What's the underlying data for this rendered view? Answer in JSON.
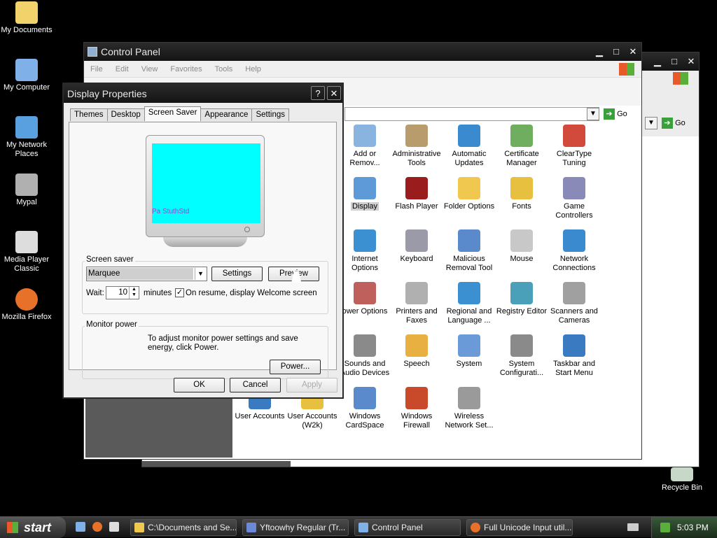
{
  "desktop": {
    "icons": [
      {
        "label": "My Documents",
        "color": "#f2d36b"
      },
      {
        "label": "My Computer",
        "color": "#7fb0e8"
      },
      {
        "label": "My Network Places",
        "color": "#59a0e0"
      },
      {
        "label": "Mypal",
        "color": "#b0b0b0"
      },
      {
        "label": "Media Player Classic",
        "color": "#dddddd"
      },
      {
        "label": "Mozilla Firefox",
        "color": "#e8712a"
      }
    ],
    "recycle_bin": "Recycle Bin"
  },
  "control_panel": {
    "title": "Control Panel",
    "menu": [
      "File",
      "Edit",
      "View",
      "Favorites",
      "Tools",
      "Help"
    ],
    "go_label": "Go",
    "items": [
      {
        "label": "Add or Remov...",
        "color": "#8ab4e0"
      },
      {
        "label": "Administrative Tools",
        "color": "#b89c6c"
      },
      {
        "label": "Automatic Updates",
        "color": "#3a8ad0"
      },
      {
        "label": "Certificate Manager",
        "color": "#6fae5f"
      },
      {
        "label": "ClearType Tuning",
        "color": "#d24a3c"
      },
      {
        "label": "Display",
        "color": "#5e9ad8"
      },
      {
        "label": "Flash Player",
        "color": "#9b1c1c"
      },
      {
        "label": "Folder Options",
        "color": "#f0c850"
      },
      {
        "label": "Fonts",
        "color": "#e8c040"
      },
      {
        "label": "Game Controllers",
        "color": "#8a8ab8"
      },
      {
        "label": "Internet Options",
        "color": "#3a90d0"
      },
      {
        "label": "Keyboard",
        "color": "#9a9aa8"
      },
      {
        "label": "Malicious Removal Tool",
        "color": "#5a8acb"
      },
      {
        "label": "Mouse",
        "color": "#c8c8c8"
      },
      {
        "label": "Network Connections",
        "color": "#3a8ad0"
      },
      {
        "label": "ower Options",
        "color": "#c0605c"
      },
      {
        "label": "Printers and Faxes",
        "color": "#b0b0b0"
      },
      {
        "label": "Regional and Language ...",
        "color": "#3a90d0"
      },
      {
        "label": "Registry Editor",
        "color": "#4aa0b8"
      },
      {
        "label": "Scanners and Cameras",
        "color": "#a0a0a0"
      },
      {
        "label": "Sounds and Audio Devices",
        "color": "#8a8a8a"
      },
      {
        "label": "Speech",
        "color": "#e8b040"
      },
      {
        "label": "System",
        "color": "#6a9ad8"
      },
      {
        "label": "System Configurati...",
        "color": "#8a8a8a"
      },
      {
        "label": "Taskbar and Start Menu",
        "color": "#3a7ac0"
      },
      {
        "label": "User Accounts",
        "color": "#3a7ac0"
      },
      {
        "label": "User Accounts (W2k)",
        "color": "#e8c040"
      },
      {
        "label": "Windows CardSpace",
        "color": "#5a8acb"
      },
      {
        "label": "Windows Firewall",
        "color": "#c84a2a"
      },
      {
        "label": "Wireless Network Set...",
        "color": "#9a9a9a"
      }
    ]
  },
  "dialog": {
    "title": "Display Properties",
    "help_btn": "?",
    "close_btn": "✕",
    "tabs": [
      "Themes",
      "Desktop",
      "Screen Saver",
      "Appearance",
      "Settings"
    ],
    "active_tab": "Screen Saver",
    "preview_text": "Pa StuthStd",
    "screen_color": "#00ffff",
    "screen_saver_group": "Screen saver",
    "screen_saver_value": "Marquee",
    "settings_btn": "Settings",
    "preview_btn": "Preview",
    "wait_label": "Wait:",
    "wait_value": "10",
    "minutes_label": "minutes",
    "resume_checked": true,
    "resume_label": "On resume, display Welcome screen",
    "monitor_group": "Monitor power",
    "monitor_text": "To adjust monitor power settings and save energy, click Power.",
    "power_btn": "Power...",
    "ok_btn": "OK",
    "cancel_btn": "Cancel",
    "apply_btn": "Apply"
  },
  "taskbar": {
    "start": "start",
    "tasks": [
      {
        "label": "C:\\Documents and Se...",
        "color": "#f0c850"
      },
      {
        "label": "Yftoowhy Regular (Tr...",
        "color": "#6a8ad8"
      },
      {
        "label": "Control Panel",
        "color": "#7fb0e8"
      },
      {
        "label": "Full Unicode Input util...",
        "color": "#e8712a"
      }
    ],
    "clock": "5:03 PM"
  }
}
